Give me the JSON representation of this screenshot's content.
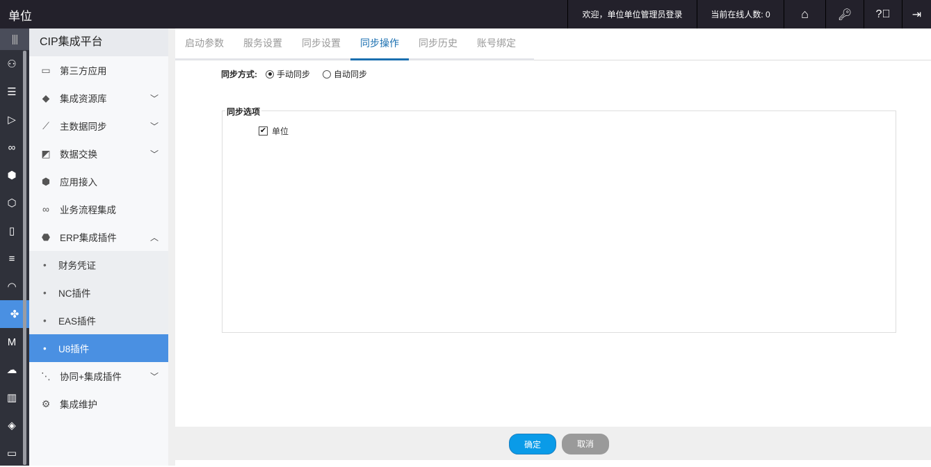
{
  "header": {
    "title": "单位",
    "welcome": "欢迎，单位单位管理员登录",
    "online": "当前在线人数: 0"
  },
  "sidebar": {
    "title": "CIP集成平台",
    "items": [
      {
        "label": "第三方应用",
        "icon": "monitor-icon"
      },
      {
        "label": "集成资源库",
        "icon": "tag-icon",
        "chevron": "down"
      },
      {
        "label": "主数据同步",
        "icon": "graph-icon",
        "chevron": "down"
      },
      {
        "label": "数据交换",
        "icon": "exchange-icon",
        "chevron": "down"
      },
      {
        "label": "应用接入",
        "icon": "cube-icon"
      },
      {
        "label": "业务流程集成",
        "icon": "flow-icon"
      },
      {
        "label": "ERP集成插件",
        "icon": "erp-icon",
        "chevron": "up"
      }
    ],
    "subitems": [
      "财务凭证",
      "NC插件",
      "EAS插件",
      "U8插件"
    ],
    "after": [
      {
        "label": "协同+集成插件",
        "icon": "share-icon",
        "chevron": "down"
      },
      {
        "label": "集成维护",
        "icon": "gear-icon"
      }
    ]
  },
  "tabs": [
    "启动参数",
    "服务设置",
    "同步设置",
    "同步操作",
    "同步历史",
    "账号绑定"
  ],
  "form": {
    "mode_label": "同步方式:",
    "manual": "手动同步",
    "auto": "自动同步",
    "options_legend": "同步选项",
    "option_unit": "单位"
  },
  "buttons": {
    "ok": "确定",
    "cancel": "取消"
  }
}
